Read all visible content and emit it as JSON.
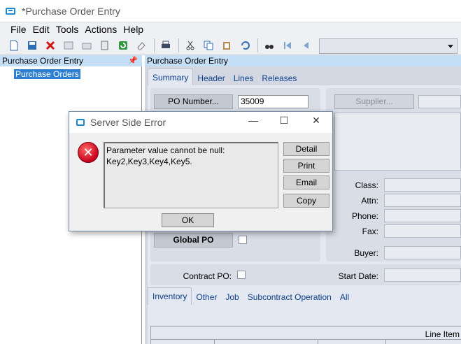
{
  "window": {
    "title": "*Purchase Order Entry",
    "icon": "app-window-icon"
  },
  "menu": [
    "File",
    "Edit",
    "Tools",
    "Actions",
    "Help"
  ],
  "toolbar": {
    "combo_value": ""
  },
  "left_panel": {
    "header": "Purchase Order Entry",
    "tree_item": "Purchase Orders"
  },
  "right_panel": {
    "header": "Purchase Order Entry",
    "tabs": [
      "Summary",
      "Header",
      "Lines",
      "Releases"
    ],
    "po_number_button": "PO Number...",
    "po_number_value": "35009",
    "supplier_button": "Supplier...",
    "global_po_button": "Global PO",
    "labels": {
      "class": "Class:",
      "attn": "Attn:",
      "phone": "Phone:",
      "fax": "Fax:",
      "buyer": "Buyer:",
      "contract_po": "Contract PO:",
      "start_date": "Start Date:"
    },
    "subtabs": [
      "Inventory",
      "Other",
      "Job",
      "Subcontract Operation",
      "All"
    ],
    "grid_caption": "Line Item"
  },
  "dialog": {
    "title": "Server Side Error",
    "message": "Parameter value cannot be null:\nKey2,Key3,Key4,Key5.",
    "buttons": {
      "detail": "Detail",
      "print": "Print",
      "email": "Email",
      "copy": "Copy",
      "ok": "OK"
    },
    "controls": {
      "minimize": "—",
      "maximize": "☐",
      "close": "✕"
    }
  }
}
